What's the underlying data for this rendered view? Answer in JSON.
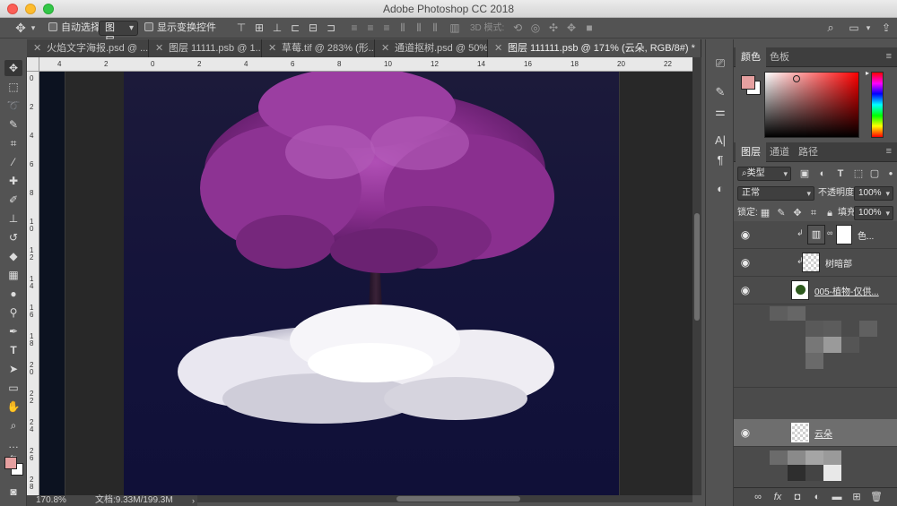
{
  "window": {
    "title": "Adobe Photoshop CC 2018"
  },
  "options_bar": {
    "auto_select_label": "自动选择:",
    "auto_select_target": "图层",
    "show_transform_label": "显示变换控件",
    "mode_3d_label": "3D 模式:"
  },
  "tabs": [
    {
      "label": "火焰文字海报.psd @ ..."
    },
    {
      "label": "图层 11111.psb @ 1..."
    },
    {
      "label": "草莓.tif @ 283% (形..."
    },
    {
      "label": "通道抠树.psd @ 50% ..."
    },
    {
      "label": "图层 111111.psb @ 171% (云朵, RGB/8#) *"
    }
  ],
  "ruler": {
    "top_labels": [
      "4",
      "2",
      "0",
      "2",
      "4",
      "6",
      "8",
      "10",
      "12",
      "14",
      "16",
      "18",
      "20",
      "22"
    ],
    "left_labels": [
      "0",
      "2",
      "4",
      "6",
      "8",
      "1\n0",
      "1\n2",
      "1\n4",
      "1\n6",
      "1\n8",
      "2\n0",
      "2\n2",
      "2\n4",
      "2\n6",
      "2\n8"
    ]
  },
  "status": {
    "zoom": "170.8%",
    "doc_info": "文档:9.33M/199.3M"
  },
  "color_panel": {
    "tabs": [
      "颜色",
      "色板"
    ],
    "foreground": "#e6a0a0",
    "background": "#ffffff"
  },
  "layers_panel": {
    "tabs": [
      "图层",
      "通道",
      "路径"
    ],
    "filter_label": "类型",
    "blend_mode": "正常",
    "opacity_label": "不透明度:",
    "opacity_value": "100%",
    "lock_label": "锁定:",
    "fill_label": "填充:",
    "fill_value": "100%",
    "layers": [
      {
        "name": "色...",
        "visible": true,
        "selected": false
      },
      {
        "name": "树暗部",
        "visible": true,
        "selected": false
      },
      {
        "name": "005-植物-仅供...",
        "visible": true,
        "selected": false
      },
      {
        "name": "",
        "visible": false,
        "selected": false
      },
      {
        "name": "云朵",
        "visible": true,
        "selected": true
      },
      {
        "name": "",
        "visible": false,
        "selected": false
      }
    ]
  },
  "accent_colors": {
    "tree": "#8a2f8f",
    "sky": "#15143a",
    "cloud": "#f2f2f2"
  }
}
